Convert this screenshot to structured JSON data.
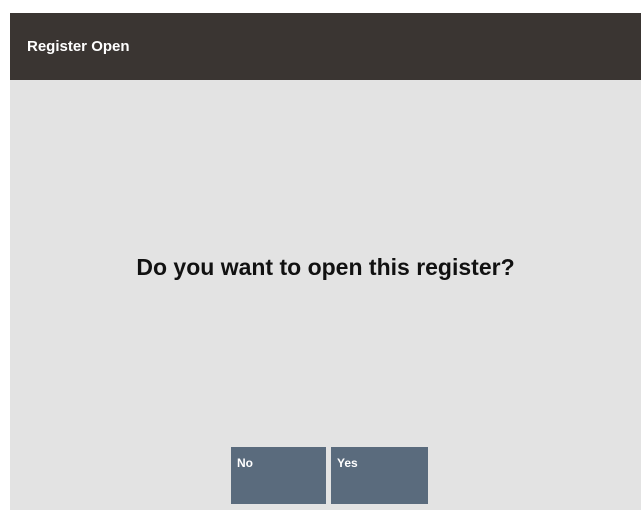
{
  "header": {
    "title": "Register Open"
  },
  "dialog": {
    "prompt": "Do you want to open this register?",
    "buttons": {
      "no_label": "No",
      "yes_label": "Yes"
    }
  }
}
